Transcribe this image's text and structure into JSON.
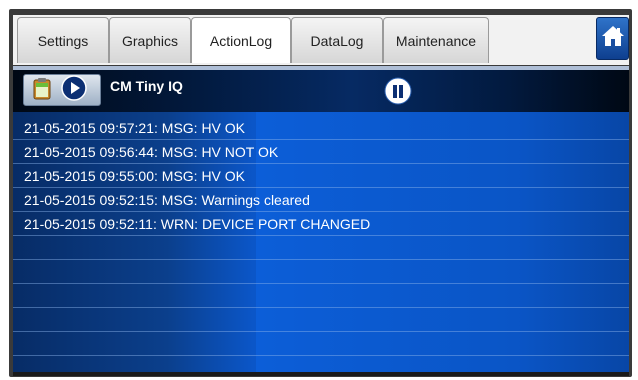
{
  "tabs": [
    {
      "label": "Settings",
      "active": false
    },
    {
      "label": "Graphics",
      "active": false
    },
    {
      "label": "ActionLog",
      "active": true
    },
    {
      "label": "DataLog",
      "active": false
    },
    {
      "label": "Maintenance",
      "active": false
    }
  ],
  "header": {
    "device_name": "CM Tiny IQ",
    "icons": [
      "clipboard-icon",
      "play-icon",
      "pause-icon",
      "home-icon"
    ]
  },
  "log": {
    "entries": [
      "21-05-2015 09:57:21: MSG: HV OK",
      "21-05-2015 09:56:44: MSG: HV NOT OK",
      "21-05-2015 09:55:00: MSG: HV OK",
      "21-05-2015 09:52:15: MSG: Warnings cleared",
      "21-05-2015 09:52:11: WRN: DEVICE PORT CHANGED",
      "",
      "",
      "",
      "",
      ""
    ]
  },
  "colors": {
    "panel_blue": "#0b56c8",
    "header_dark": "#021a3f",
    "accent_blue": "#0e3f8f"
  }
}
